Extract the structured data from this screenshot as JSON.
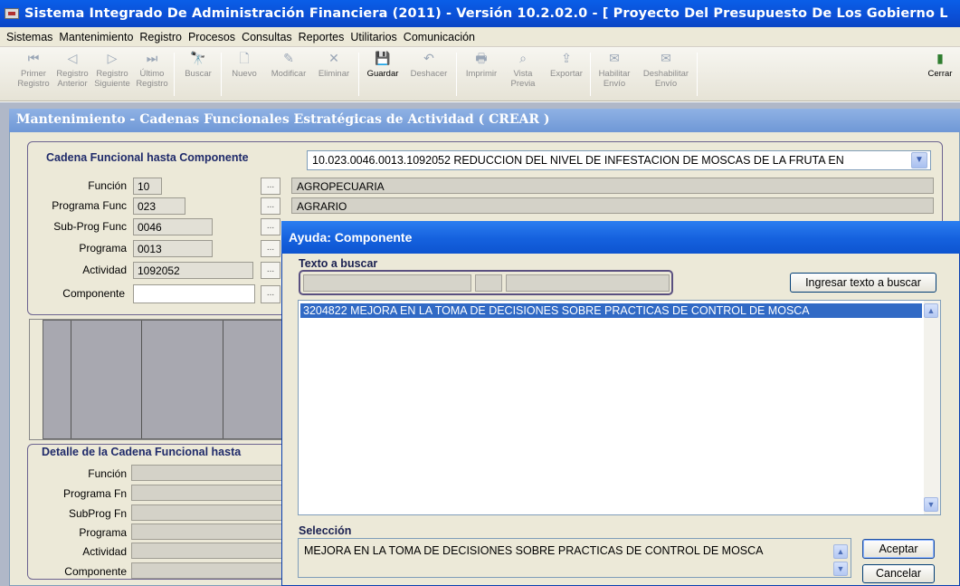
{
  "window": {
    "title": "Sistema Integrado De Administración Financiera (2011) - Versión 10.2.02.0 - [ Proyecto Del Presupuesto De Los Gobierno L"
  },
  "menu": [
    "Sistemas",
    "Mantenimiento",
    "Registro",
    "Procesos",
    "Consultas",
    "Reportes",
    "Utilitarios",
    "Comunicación"
  ],
  "toolbar": {
    "primer": [
      "Primer",
      "Registro"
    ],
    "anterior": [
      "Registro",
      "Anterior"
    ],
    "siguiente": [
      "Registro",
      "Siguiente"
    ],
    "ultimo": [
      "Último",
      "Registro"
    ],
    "buscar": "Buscar",
    "nuevo": "Nuevo",
    "modificar": "Modificar",
    "eliminar": "Eliminar",
    "guardar": "Guardar",
    "deshacer": "Deshacer",
    "imprimir": "Imprimir",
    "vista": [
      "Vista",
      "Previa"
    ],
    "exportar": "Exportar",
    "habilitar": [
      "Habilitar",
      "Envío"
    ],
    "deshabilitar": [
      "Deshabilitar",
      "Envío"
    ],
    "cerrar": "Cerrar"
  },
  "main": {
    "title": "Mantenimiento - Cadenas Funcionales Estratégicas de Actividad ( CREAR )",
    "group1": {
      "title": "Cadena Funcional hasta Componente",
      "combo_value": "10.023.0046.0013.1092052 REDUCCION DEL NIVEL DE INFESTACION DE MOSCAS DE LA FRUTA EN",
      "funcion": {
        "label": "Función",
        "value": "10",
        "desc": "AGROPECUARIA"
      },
      "programa_func": {
        "label": "Programa Func",
        "value": "023",
        "desc": "AGRARIO"
      },
      "subprog_func": {
        "label": "Sub-Prog Func",
        "value": "0046"
      },
      "programa": {
        "label": "Programa",
        "value": "0013"
      },
      "actividad": {
        "label": "Actividad",
        "value": "1092052"
      },
      "componente": {
        "label": "Componente",
        "value": ""
      }
    },
    "group2": {
      "title": "Detalle de la Cadena Funcional hasta",
      "labels": [
        "Función",
        "Programa Fn",
        "SubProg Fn",
        "Programa",
        "Actividad",
        "Componente"
      ]
    }
  },
  "dialog": {
    "title": "Ayuda: Componente",
    "search_label": "Texto a buscar",
    "search_button": "Ingresar texto a buscar",
    "list_items": [
      "3204822  MEJORA EN LA TOMA DE DECISIONES SOBRE PRACTICAS DE CONTROL DE MOSCA"
    ],
    "selection_label": "Selección",
    "selection_value": "MEJORA EN LA TOMA DE DECISIONES SOBRE PRACTICAS DE CONTROL DE MOSCA",
    "ok_button": "Aceptar",
    "cancel_button": "Cancelar"
  },
  "colors": {
    "titlebar": "#0b4fd6",
    "dialog_titlebar": "#1561de",
    "selection": "#316ac5",
    "frame_title": "#1f2a6a"
  }
}
